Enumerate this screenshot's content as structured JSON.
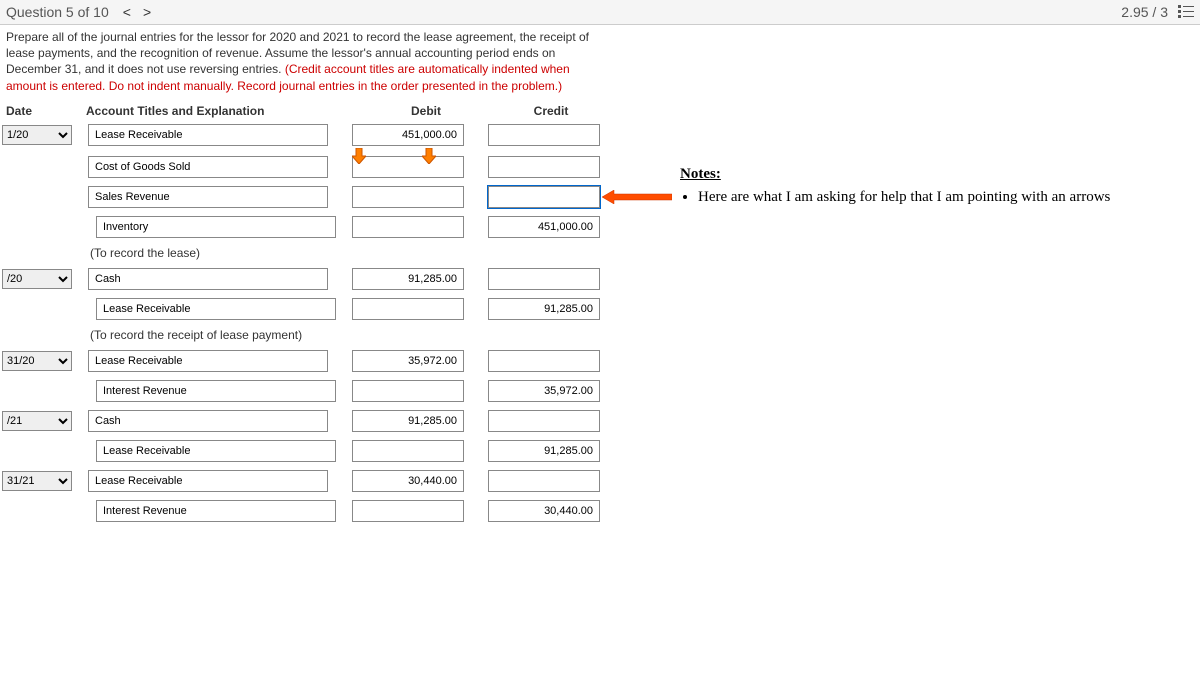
{
  "header": {
    "question": "Question 5 of 10",
    "score": "2.95 / 3"
  },
  "instructions": {
    "black": "Prepare all of the journal entries for the lessor for 2020 and 2021 to record the lease agreement, the receipt of lease payments, and the recognition of revenue. Assume the lessor's annual accounting period ends on December 31, and it does not use reversing entries. ",
    "red": "(Credit account titles are automatically indented when amount is entered. Do not indent manually. Record journal entries in the order presented in the problem.)"
  },
  "columns": {
    "date": "Date",
    "title": "Account Titles and Explanation",
    "debit": "Debit",
    "credit": "Credit"
  },
  "rows": {
    "r1": {
      "date": "1/20",
      "acct": "Lease Receivable",
      "debit": "451,000.00",
      "credit": ""
    },
    "r2": {
      "acct": "Cost of Goods Sold",
      "debit": "",
      "credit": ""
    },
    "r3": {
      "acct": "Sales Revenue",
      "debit": "",
      "credit": ""
    },
    "r4": {
      "acct": "Inventory",
      "debit": "",
      "credit": "451,000.00"
    },
    "exp1": "(To record the lease)",
    "r5": {
      "date": "/20",
      "acct": "Cash",
      "debit": "91,285.00",
      "credit": ""
    },
    "r6": {
      "acct": "Lease Receivable",
      "debit": "",
      "credit": "91,285.00"
    },
    "exp2": "(To record the receipt of lease payment)",
    "r7": {
      "date": "31/20",
      "acct": "Lease Receivable",
      "debit": "35,972.00",
      "credit": ""
    },
    "r8": {
      "acct": "Interest Revenue",
      "debit": "",
      "credit": "35,972.00"
    },
    "r9": {
      "date": "/21",
      "acct": "Cash",
      "debit": "91,285.00",
      "credit": ""
    },
    "r10": {
      "acct": "Lease Receivable",
      "debit": "",
      "credit": "91,285.00"
    },
    "r11": {
      "date": "31/21",
      "acct": "Lease Receivable",
      "debit": "30,440.00",
      "credit": ""
    },
    "r12": {
      "acct": "Interest Revenue",
      "debit": "",
      "credit": "30,440.00"
    }
  },
  "notes": {
    "title": "Notes:",
    "bullet": "Here are what I am asking for help that I am pointing with an arrows"
  }
}
